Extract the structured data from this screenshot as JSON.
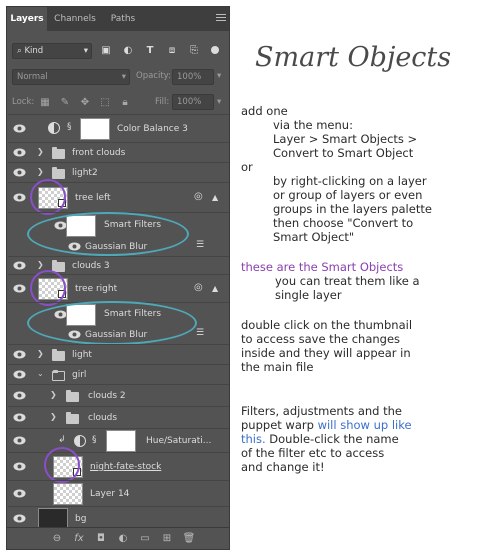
{
  "tabs": [
    {
      "label": "Layers",
      "active": true
    },
    {
      "label": "Channels",
      "active": false
    },
    {
      "label": "Paths",
      "active": false
    }
  ],
  "filter": {
    "kind_label": "Kind"
  },
  "blend": {
    "mode": "Normal",
    "opacity_label": "Opacity:",
    "opacity_value": "100%"
  },
  "lock": {
    "label": "Lock:",
    "fill_label": "Fill:",
    "fill_value": "100%"
  },
  "layers": [
    {
      "name": "Color Balance 3"
    },
    {
      "name": "front clouds"
    },
    {
      "name": "light2"
    },
    {
      "name": "tree left"
    },
    {
      "name": "Smart Filters"
    },
    {
      "name": "Gaussian Blur"
    },
    {
      "name": "clouds 3"
    },
    {
      "name": "tree right"
    },
    {
      "name": "Smart Filters"
    },
    {
      "name": "Gaussian Blur"
    },
    {
      "name": "light"
    },
    {
      "name": "girl"
    },
    {
      "name": "clouds 2"
    },
    {
      "name": "clouds"
    },
    {
      "name": "Hue/Saturati..."
    },
    {
      "name": "night-fate-stock"
    },
    {
      "name": "Layer 14"
    },
    {
      "name": "bg"
    }
  ],
  "notes": {
    "title": "Smart Objects",
    "p1": [
      "add one",
      "via the menu:",
      "Layer >  Smart Objects >",
      "Convert to Smart Object"
    ],
    "or": "or",
    "p2": [
      "by right-clicking on a layer",
      "or group of layers or even",
      "groups in the layers palette",
      "then choose \"Convert to",
      "Smart Object\""
    ],
    "p3_highlight": "these are the Smart Objects",
    "p3": [
      "you can treat them like a",
      "single layer"
    ],
    "p4": [
      "double click on the thumbnail",
      "to access save the changes",
      "inside and they will appear in",
      "the main file"
    ],
    "p5_l1": "Filters, adjustments and the",
    "p5_l2a": "puppet warp ",
    "p5_l2b": "will show up like",
    "p5_l3a": "this.",
    "p5_l3b": " Double-click the name",
    "p5_l4": "of the filter etc to access",
    "p5_l5": "and change it!"
  },
  "colors": {
    "annotation_purple": "#8a4ec8",
    "annotation_teal": "#4fa8b8",
    "highlight_text": "#8b3fb0",
    "link_text": "#3a6fcc"
  }
}
